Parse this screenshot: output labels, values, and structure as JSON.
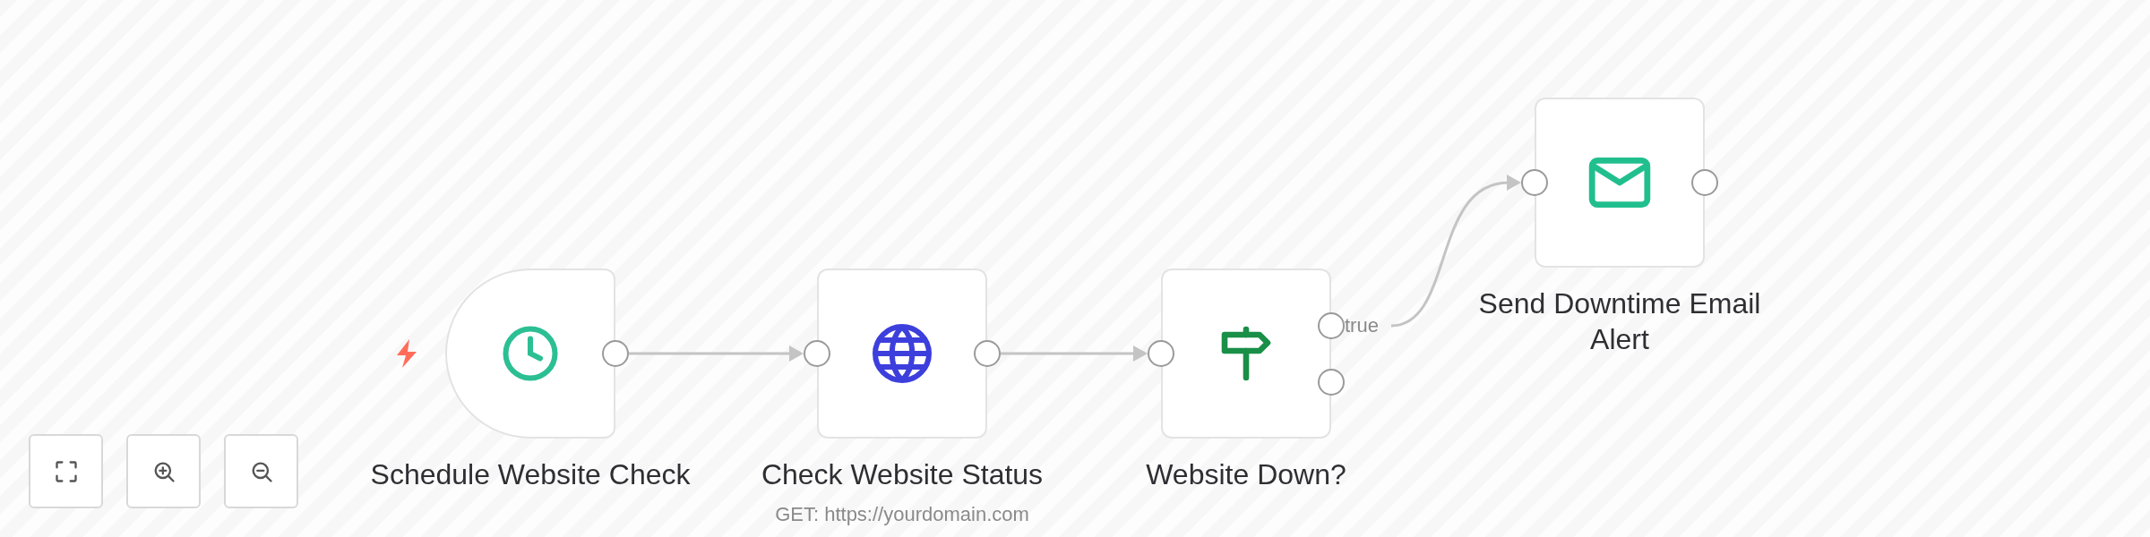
{
  "nodes": [
    {
      "kind": "trigger",
      "title": "Schedule Website Check"
    },
    {
      "kind": "action",
      "title": "Check Website Status",
      "subtitle": "GET: https://yourdomain.com"
    },
    {
      "kind": "condition",
      "title": "Website Down?",
      "output_label": "true"
    },
    {
      "kind": "action",
      "title": "Send Downtime Email Alert"
    }
  ],
  "zoom_controls": [
    {
      "kind": "fit"
    },
    {
      "kind": "zoom-in"
    },
    {
      "kind": "zoom-out"
    }
  ]
}
